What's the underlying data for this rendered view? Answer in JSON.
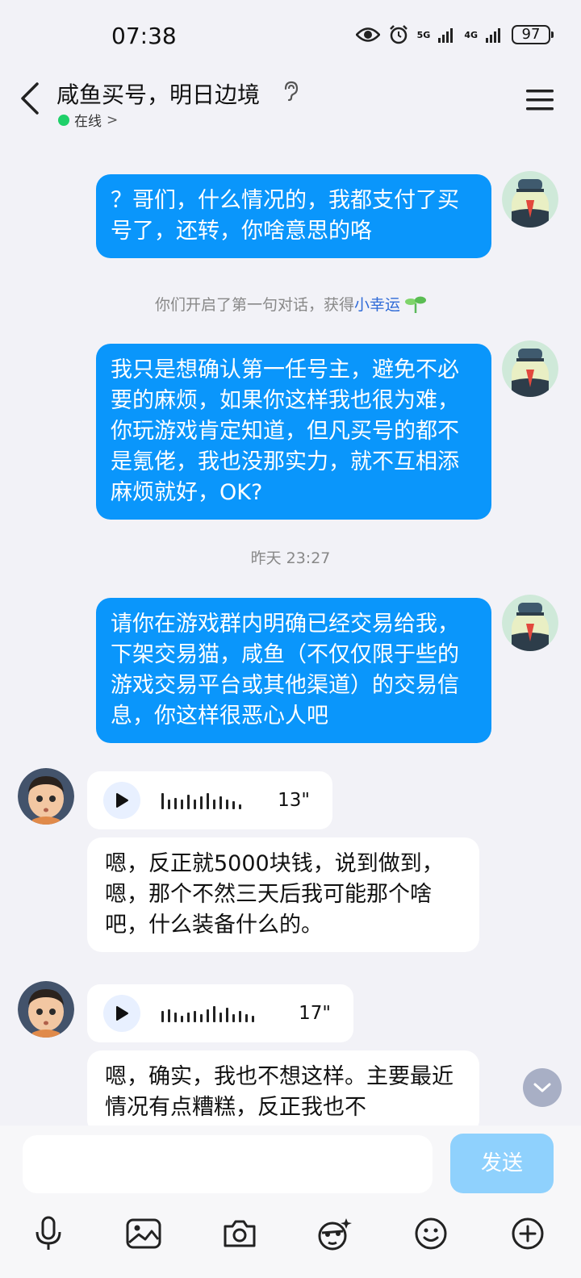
{
  "status_bar": {
    "time": "07:38",
    "net1": "5G",
    "net2": "4G",
    "battery": "97"
  },
  "header": {
    "title": "咸鱼买号，明日边境",
    "status": "在线",
    "status_arrow": ">"
  },
  "messages": {
    "m1": "？哥们，什么情况的，我都支付了买号了，还转，你啥意思的咯",
    "sys_prefix": "你们开启了第一句对话，获得",
    "sys_highlight": "小幸运",
    "m2": "我只是想确认第一任号主，避免不必要的麻烦，如果你这样我也很为难，你玩游戏肯定知道，但凡买号的都不是氪佬，我也没那实力，就不互相添麻烦就好，OK?",
    "time_sep": "昨天 23:27",
    "m3": "请你在游戏群内明确已经交易给我，下架交易猫，咸鱼（不仅仅限于些的游戏交易平台或其他渠道）的交易信息，你这样很恶心人吧",
    "voice1_duration": "13\"",
    "m4": "嗯，反正就5000块钱，说到做到，嗯，那个不然三天后我可能那个啥吧，什么装备什么的。",
    "voice2_duration": "17\"",
    "m5": "嗯，确实，我也不想这样。主要最近情况有点糟糕，反正我也不"
  },
  "input": {
    "value": "",
    "send_label": "发送"
  },
  "toolbar": [
    "mic-icon",
    "image-icon",
    "camera-icon",
    "sticker-icon",
    "emoji-icon",
    "plus-icon"
  ],
  "colors": {
    "bubble_out": "#0a96fb",
    "online": "#1fd069",
    "link": "#2e6ad7",
    "send_disabled": "#8fd1fd"
  }
}
